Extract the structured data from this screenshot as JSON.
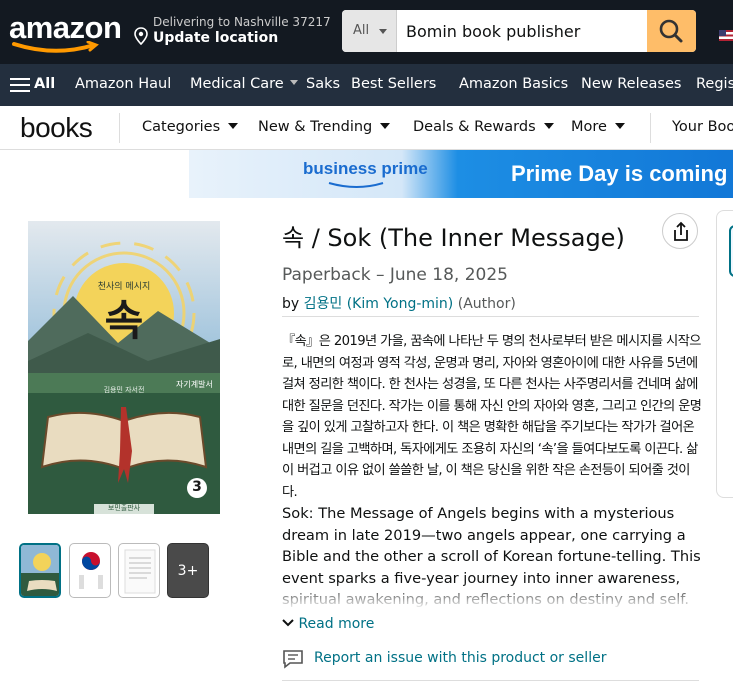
{
  "header": {
    "logo": "amazon",
    "deliver_line1": "Delivering to Nashville 37217",
    "deliver_line2": "Update location",
    "search_category": "All",
    "search_value": "Bomin book publisher"
  },
  "main_nav": {
    "all_label": "All",
    "items": [
      "Amazon Haul",
      "Medical Care",
      "Saks",
      "Best Sellers",
      "Amazon Basics",
      "New Releases",
      "Regis"
    ]
  },
  "books_nav": {
    "logo": "books",
    "items": [
      "Categories",
      "New & Trending",
      "Deals & Rewards",
      "More",
      "Your Boo"
    ]
  },
  "banner": {
    "brand": "business prime",
    "headline": "Prime Day is coming | Ju"
  },
  "cover": {
    "small_title": "천사의 메시지",
    "big_title": "속",
    "author_line": "김용민 자서전",
    "series_tag": "자기계발서",
    "volume": "3",
    "publisher": "보민출판사"
  },
  "thumbnails": {
    "more_label": "3+"
  },
  "product": {
    "title": "속 / Sok (The Inner Message)",
    "format_date": "Paperback – June 18, 2025",
    "by_prefix": "by",
    "author": "김용민 (Kim Yong-min)",
    "role": "(Author)",
    "description_ko": "『속』은 2019년 가을, 꿈속에 나타난 두 명의 천사로부터 받은 메시지를 시작으로, 내면의 여정과 영적 각성, 운명과 명리, 자아와 영혼아이에 대한 사유를 5년에 걸쳐 정리한 책이다. 한 천사는 성경을, 또 다른 천사는 사주명리서를 건네며 삶에 대한 질문을 던진다. 작가는 이를 통해 자신 안의 자아와 영혼, 그리고 인간의 운명을 깊이 있게 고찰하고자 한다. 이 책은 명확한 해답을 주기보다는 작가가 걸어온 내면의 길을 고백하며, 독자에게도 조용히 자신의 ‘속’을 들여다보도록 이끈다. 삶이 버겁고 이유 없이 쓸쓸한 날, 이 책은 당신을 위한 작은 손전등이 되어줄 것이다.",
    "description_en": "Sok: The Message of Angels begins with a mysterious dream in late 2019—two angels appear, one carrying a Bible and the other a scroll of Korean fortune-telling. This event sparks a five-year journey into inner awareness, spiritual awakening, and reflections on destiny and self. Rather than",
    "read_more": "Read more",
    "report": "Report an issue with this product or seller"
  },
  "colors": {
    "nav_dark": "#131921",
    "nav_secondary": "#232f3e",
    "search_button": "#febd69",
    "link": "#007185"
  }
}
